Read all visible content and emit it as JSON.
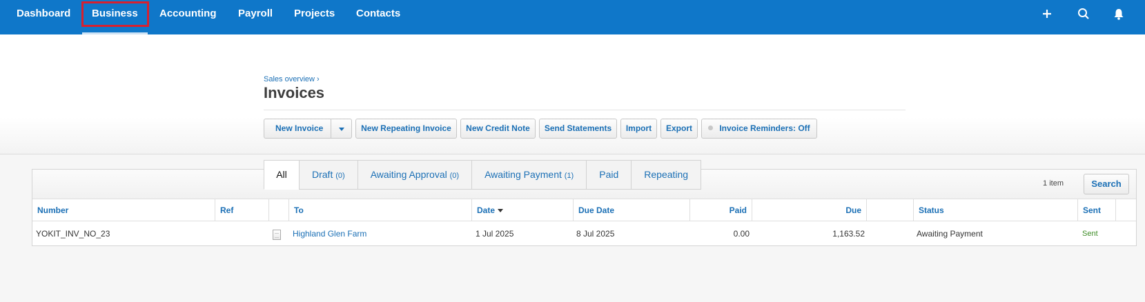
{
  "nav": {
    "items": [
      "Dashboard",
      "Business",
      "Accounting",
      "Payroll",
      "Projects",
      "Contacts"
    ],
    "active": "Business",
    "icons": [
      "plus-icon",
      "search-icon",
      "bell-icon"
    ],
    "bar_color": "#0f77c9",
    "highlight_color": "#d8202e"
  },
  "breadcrumb": "Sales overview ›",
  "page_title": "Invoices",
  "toolbar": {
    "new_invoice": "New Invoice",
    "new_repeating_invoice": "New Repeating Invoice",
    "new_credit_note": "New Credit Note",
    "send_statements": "Send Statements",
    "import": "Import",
    "export": "Export",
    "invoice_reminders": "Invoice Reminders: Off"
  },
  "tabs": [
    {
      "label": "All",
      "count": ""
    },
    {
      "label": "Draft",
      "count": "(0)"
    },
    {
      "label": "Awaiting Approval",
      "count": "(0)"
    },
    {
      "label": "Awaiting Payment",
      "count": "(1)"
    },
    {
      "label": "Paid",
      "count": ""
    },
    {
      "label": "Repeating",
      "count": ""
    }
  ],
  "active_tab": "All",
  "list": {
    "item_count": "1 item",
    "search_label": "Search",
    "columns": {
      "number": "Number",
      "ref": "Ref",
      "to": "To",
      "date": "Date",
      "due_date": "Due Date",
      "paid": "Paid",
      "due": "Due",
      "status": "Status",
      "sent": "Sent"
    },
    "rows": [
      {
        "number": "YOKIT_INV_NO_23",
        "ref": "",
        "to": "Highland Glen Farm",
        "date": "1 Jul 2025",
        "due_date": "8 Jul 2025",
        "paid": "0.00",
        "due": "1,163.52",
        "status": "Awaiting Payment",
        "sent": "Sent"
      }
    ]
  }
}
